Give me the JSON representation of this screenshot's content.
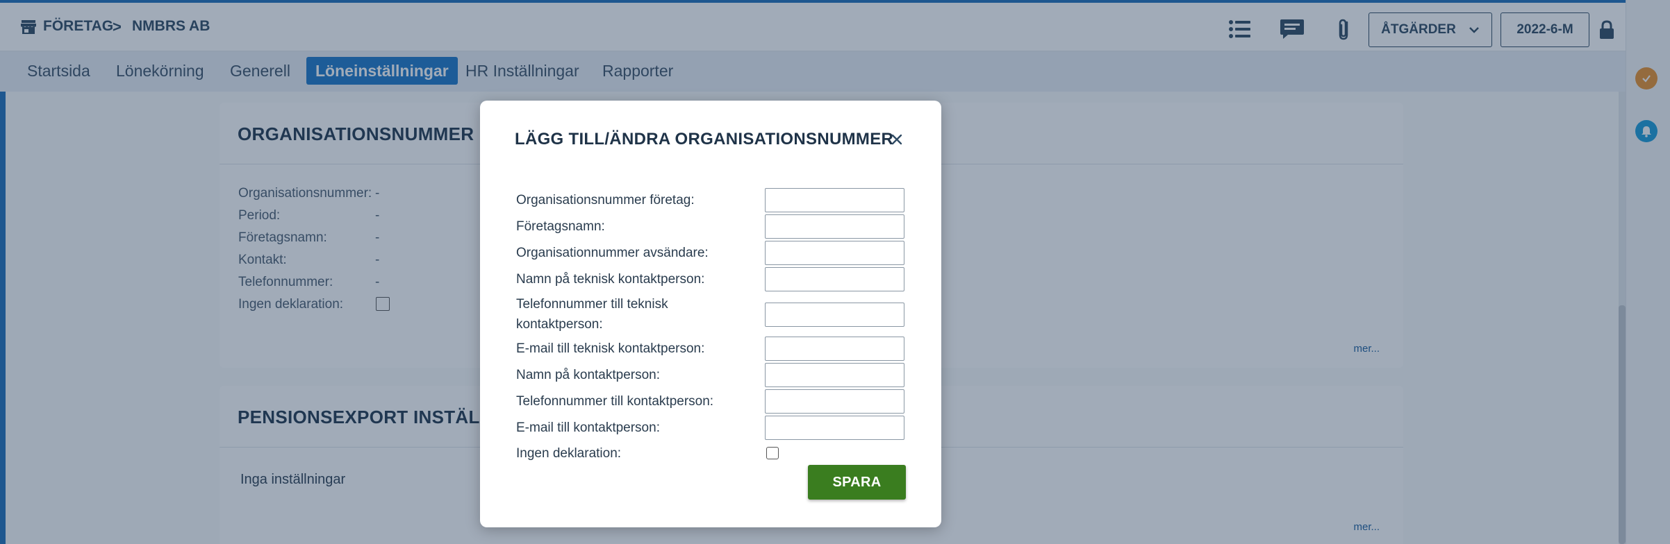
{
  "breadcrumb": {
    "icon": "shop-icon",
    "company_label": "FÖRETAG",
    "separator": ">",
    "current": "NMBRS AB"
  },
  "toolbar": {
    "actions_label": "ÅTGÄRDER",
    "period_label": "2022-6-M",
    "icons": [
      "list-icon",
      "chat-icon",
      "paperclip-icon",
      "lock-icon",
      "hamburger-menu-icon"
    ]
  },
  "tabs": [
    {
      "label": "Startsida",
      "active": false
    },
    {
      "label": "Lönekörning",
      "active": false
    },
    {
      "label": "Generell",
      "active": false
    },
    {
      "label": "Löneinställningar",
      "active": true
    },
    {
      "label": "HR Inställningar",
      "active": false
    },
    {
      "label": "Rapporter",
      "active": false
    }
  ],
  "org_card": {
    "title": "ORGANISATIONSNUMMER",
    "fields": [
      {
        "label": "Organisationsnummer:",
        "value": "-"
      },
      {
        "label": "Period:",
        "value": "-"
      },
      {
        "label": "Företagsnamn:",
        "value": "-"
      },
      {
        "label": "Kontakt:",
        "value": "-"
      },
      {
        "label": "Telefonnummer:",
        "value": "-"
      },
      {
        "label": "Ingen deklaration:",
        "value": ""
      }
    ],
    "more_link": "mer..."
  },
  "pension_card": {
    "title": "PENSIONSEXPORT INSTÄLLNI",
    "empty_text": "Inga inställningar",
    "more_link": "mer..."
  },
  "modal": {
    "title": "LÄGG TILL/ÄNDRA ORGANISATIONSNUMMER",
    "fields": [
      {
        "label": "Organisationsnummer företag:",
        "value": ""
      },
      {
        "label": "Företagsnamn:",
        "value": ""
      },
      {
        "label": "Organisationnummer avsändare:",
        "value": ""
      },
      {
        "label": "Namn på teknisk kontaktperson:",
        "value": ""
      },
      {
        "label": "Telefonnummer till teknisk kontaktperson:",
        "value": ""
      },
      {
        "label": "E-mail till teknisk kontaktperson:",
        "value": ""
      },
      {
        "label": "Namn på kontaktperson:",
        "value": ""
      },
      {
        "label": "Telefonnummer till kontaktperson:",
        "value": ""
      },
      {
        "label": "E-mail till kontaktperson:",
        "value": ""
      }
    ],
    "checkbox_label": "Ingen deklaration:",
    "checkbox_checked": false,
    "save_label": "SPARA"
  },
  "colors": {
    "accent": "#1d78c8",
    "save_button": "#3a7d1f",
    "overlay": "rgba(30,55,85,0.42)"
  }
}
